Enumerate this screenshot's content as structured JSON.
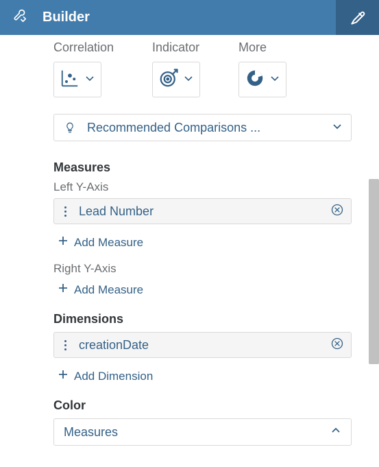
{
  "header": {
    "title": "Builder"
  },
  "vis": {
    "correlation": "Correlation",
    "indicator": "Indicator",
    "more": "More"
  },
  "reco": {
    "text": "Recommended Comparisons ..."
  },
  "sections": {
    "measures": "Measures",
    "left_y": "Left Y-Axis",
    "right_y": "Right Y-Axis",
    "dimensions": "Dimensions",
    "color": "Color"
  },
  "tokens": {
    "measure1": "Lead Number",
    "dimension1": "creationDate",
    "color_value": "Measures"
  },
  "actions": {
    "add_measure": "Add Measure",
    "add_dimension": "Add Dimension"
  },
  "colors": {
    "brand": "#346187",
    "header": "#427cac",
    "muted": "#6a6d70"
  }
}
